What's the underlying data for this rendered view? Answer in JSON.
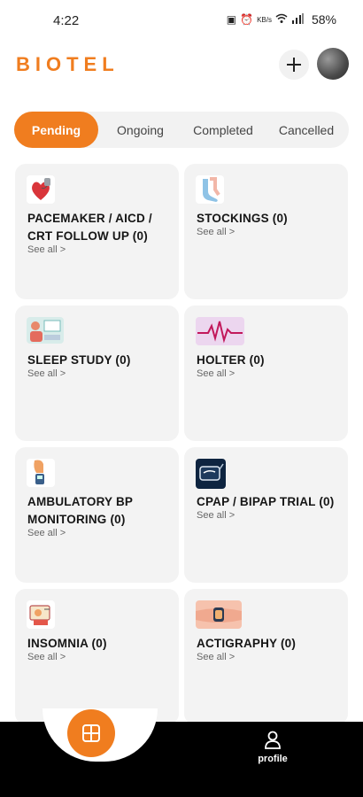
{
  "status_bar": {
    "time": "4:22",
    "icons": [
      "sim-icon",
      "alarm-icon",
      "data-speed-icon",
      "wifi-icon",
      "signal-icon"
    ],
    "battery": "58%"
  },
  "header": {
    "logo": "BIOTEL",
    "add_icon": "plus-icon"
  },
  "tabs": [
    {
      "label": "Pending",
      "active": true
    },
    {
      "label": "Ongoing",
      "active": false
    },
    {
      "label": "Completed",
      "active": false
    },
    {
      "label": "Cancelled",
      "active": false
    }
  ],
  "cards": [
    {
      "title": "PACEMAKER / AICD / CRT FOLLOW UP (0)",
      "see_all": "See all >",
      "icon": "heart-pacemaker-icon"
    },
    {
      "title": "STOCKINGS (0)",
      "see_all": "See all >",
      "icon": "stockings-icon"
    },
    {
      "title": "SLEEP STUDY (0)",
      "see_all": "See all >",
      "icon": "sleep-study-icon"
    },
    {
      "title": "HOLTER  (0)",
      "see_all": "See all >",
      "icon": "holter-ecg-icon"
    },
    {
      "title": "AMBULATORY BP MONITORING (0)",
      "see_all": "See all >",
      "icon": "bp-monitor-icon"
    },
    {
      "title": "CPAP / BIPAP TRIAL (0)",
      "see_all": "See all >",
      "icon": "cpap-mask-icon"
    },
    {
      "title": "INSOMNIA (0)",
      "see_all": "See all >",
      "icon": "insomnia-icon"
    },
    {
      "title": "ACTIGRAPHY (0)",
      "see_all": "See all >",
      "icon": "actigraphy-watch-icon"
    }
  ],
  "bottom_nav": {
    "home_icon": "grid-icon",
    "profile_label": "profile",
    "profile_icon": "user-icon"
  },
  "colors": {
    "accent": "#f07d1f",
    "card_bg": "#f3f3f3",
    "nav_bg": "#000000"
  }
}
